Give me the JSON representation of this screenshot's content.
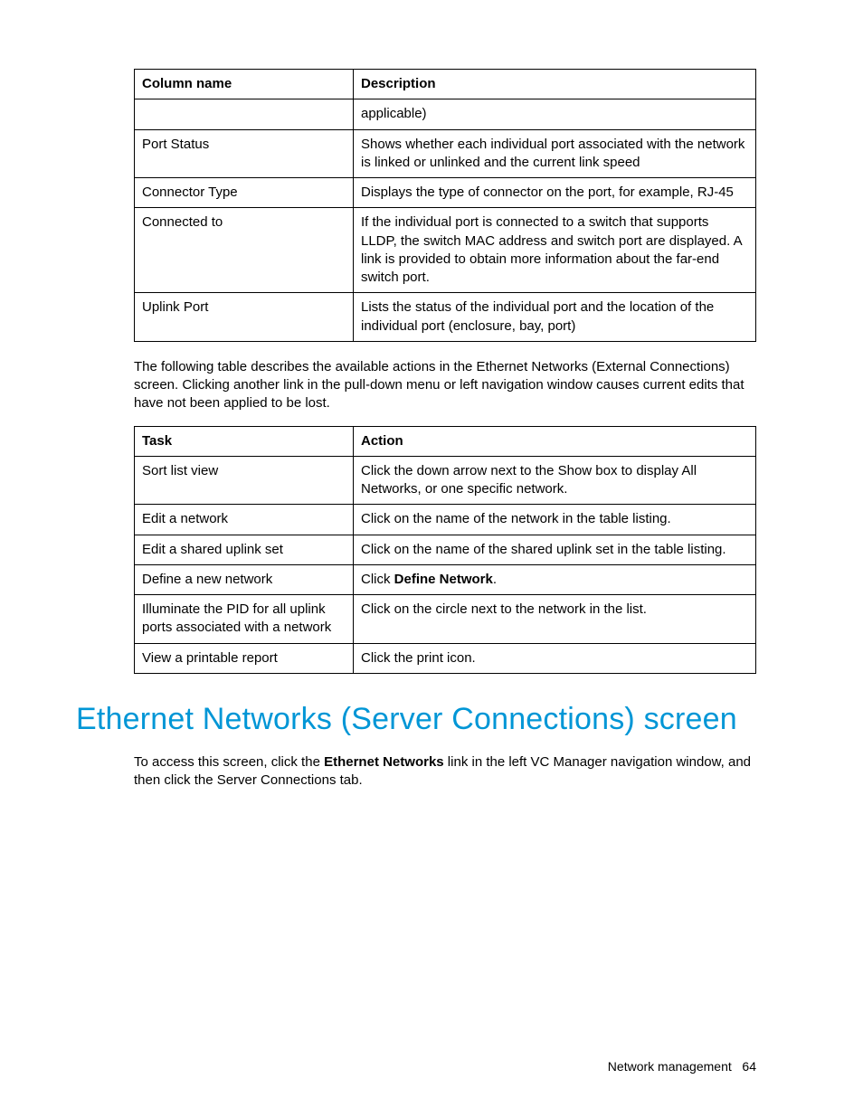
{
  "table1": {
    "headers": [
      "Column name",
      "Description"
    ],
    "rows": [
      {
        "c0": "",
        "c1": "applicable)"
      },
      {
        "c0": "Port Status",
        "c1": "Shows whether each individual port associated with the network is linked or unlinked and the current link speed"
      },
      {
        "c0": "Connector Type",
        "c1": "Displays the type of connector on the port, for example, RJ-45"
      },
      {
        "c0": "Connected to",
        "c1": "If the individual port is connected to a switch that supports LLDP, the switch MAC address and switch port are displayed. A link is provided to obtain more information about the far-end switch port."
      },
      {
        "c0": "Uplink Port",
        "c1": "Lists the status of the individual port and the location of the individual port (enclosure, bay, port)"
      }
    ]
  },
  "para1": "The following table describes the available actions in the Ethernet Networks (External Connections) screen. Clicking another link in the pull-down menu or left navigation window causes current edits that have not been applied to be lost.",
  "table2": {
    "headers": [
      "Task",
      "Action"
    ],
    "rows": [
      {
        "c0": "Sort list view",
        "c1": "Click the down arrow next to the Show box to display All Networks, or one specific network."
      },
      {
        "c0": "Edit a network",
        "c1": "Click on the name of the network in the table listing."
      },
      {
        "c0": "Edit a shared uplink set",
        "c1": "Click on the name of the shared uplink set in the table listing."
      },
      {
        "c0": "Define a new network",
        "c1_pre": "Click ",
        "c1_bold": "Define Network",
        "c1_post": "."
      },
      {
        "c0": "Illuminate the PID for all uplink ports associated with a network",
        "c1": "Click on the circle next to the network in the list."
      },
      {
        "c0": "View a printable report",
        "c1": "Click the print icon."
      }
    ]
  },
  "heading": "Ethernet Networks (Server Connections) screen",
  "para2_pre": "To access this screen, click the ",
  "para2_bold": "Ethernet Networks",
  "para2_post": " link in the left VC Manager navigation window, and then click the Server Connections tab.",
  "footer_label": "Network management",
  "footer_page": "64"
}
